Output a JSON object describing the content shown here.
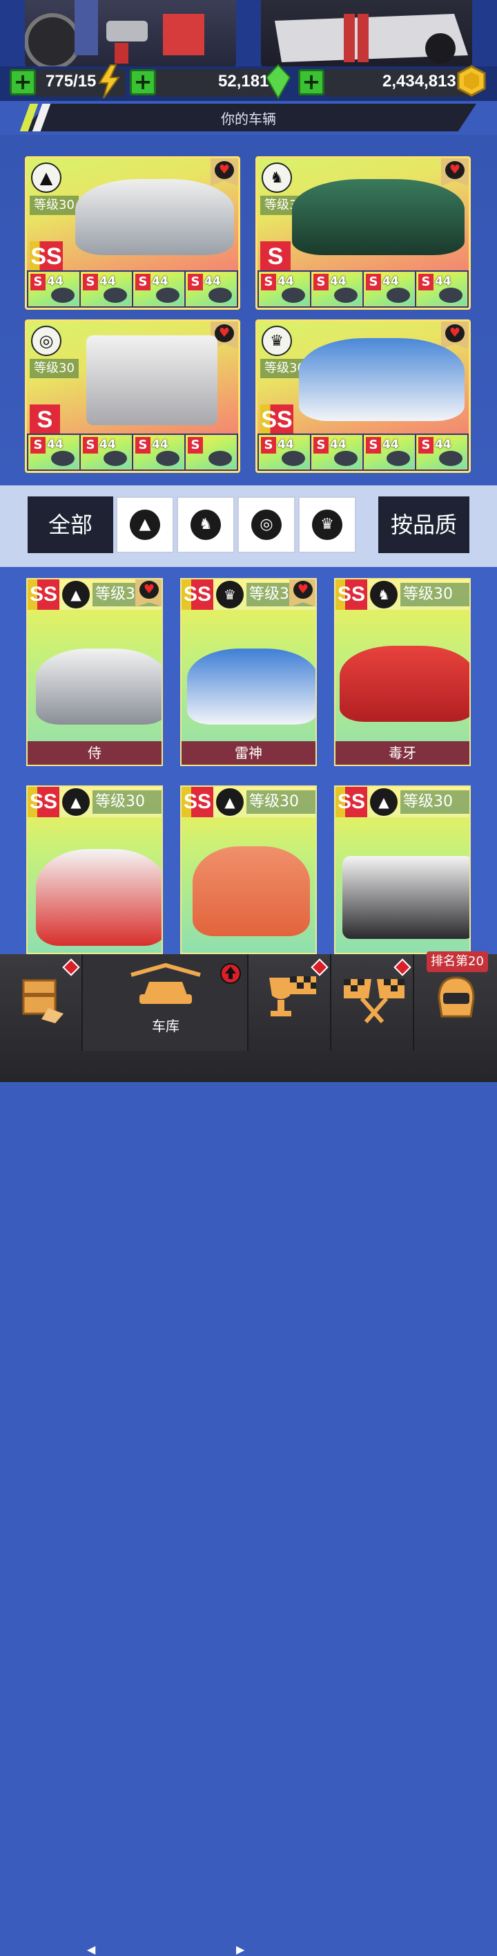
{
  "header": {
    "energy": "775/15",
    "gems": "52,181",
    "coins": "2,434,813",
    "section_title": "你的车辆"
  },
  "featured": [
    {
      "type_icon": "road-icon",
      "level": "等级30",
      "class": "SS",
      "parts": [
        "44",
        "44",
        "44",
        "44"
      ],
      "favorite": true
    },
    {
      "type_icon": "horse-icon",
      "level": "等级30",
      "class": "S",
      "parts": [
        "44",
        "44",
        "44",
        "44"
      ],
      "favorite": true
    },
    {
      "type_icon": "wheel-icon",
      "level": "等级30",
      "class": "S",
      "parts": [
        "44",
        "44",
        "44",
        ""
      ],
      "favorite": true
    },
    {
      "type_icon": "crown-icon",
      "level": "等级30",
      "class": "SS",
      "parts": [
        "44",
        "44",
        "44",
        "44"
      ],
      "favorite": true
    }
  ],
  "part_class": "S",
  "filters": {
    "all": "全部",
    "by_quality": "按品质"
  },
  "cars": [
    {
      "class": "SS",
      "level": "等级3",
      "name": "侍",
      "favorite": true,
      "icon": "road-icon"
    },
    {
      "class": "SS",
      "level": "等级3",
      "name": "雷神",
      "favorite": true,
      "icon": "crown-icon"
    },
    {
      "class": "SS",
      "level": "等级30",
      "name": "毒牙",
      "favorite": false,
      "icon": "horse-icon"
    },
    {
      "class": "SS",
      "level": "等级30",
      "name": "",
      "favorite": false,
      "icon": "road-icon"
    },
    {
      "class": "SS",
      "level": "等级30",
      "name": "",
      "favorite": false,
      "icon": "road-icon"
    },
    {
      "class": "SS",
      "level": "等级30",
      "name": "",
      "favorite": false,
      "icon": "road-icon"
    }
  ],
  "nav": {
    "garage_label": "车库",
    "rank_label": "排名第20"
  },
  "colors": {
    "accent_green": "#39c233",
    "class_red": "#e02a3a",
    "bg_blue": "#3a5cbc"
  }
}
